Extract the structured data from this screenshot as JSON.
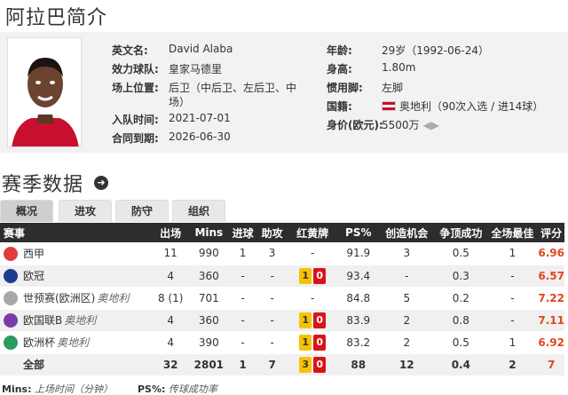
{
  "page_title": "阿拉巴简介",
  "profile": {
    "labels": {
      "en_name": "英文名:",
      "club": "效力球队:",
      "position": "场上位置:",
      "join_date": "入队时间:",
      "contract": "合同到期:",
      "age": "年龄:",
      "height": "身高:",
      "foot": "惯用脚:",
      "nation": "国籍:",
      "value": "身价(欧元):"
    },
    "values": {
      "en_name": "David Alaba",
      "club": "皇家马德里",
      "position_line1": "后卫（中后卫、左后卫、中",
      "position_line2": "场）",
      "join_date": "2021-07-01",
      "contract": "2026-06-30",
      "age": "29岁（1992-06-24）",
      "height": "1.80m",
      "foot": "左脚",
      "nation": "奥地利（90次入选 / 进14球）",
      "value": "5500万"
    }
  },
  "section_title": "赛季数据",
  "tabs": [
    "概况",
    "进攻",
    "防守",
    "组织"
  ],
  "table": {
    "headers": [
      "赛事",
      "出场",
      "Mins",
      "进球",
      "助攻",
      "红黄牌",
      "PS%",
      "创造机会",
      "争顶成功",
      "全场最佳",
      "评分"
    ],
    "rows": [
      {
        "comp": "西甲",
        "sub": "",
        "apps": "11",
        "mins": "990",
        "goals": "1",
        "assists": "3",
        "cards": "-",
        "y": "",
        "r": "",
        "ps": "91.9",
        "chances": "3",
        "aerial": "0.5",
        "motm": "1",
        "rating": "6.96",
        "icon_color": "#e23b3b"
      },
      {
        "comp": "欧冠",
        "sub": "",
        "apps": "4",
        "mins": "360",
        "goals": "-",
        "assists": "-",
        "cards": "",
        "y": "1",
        "r": "0",
        "ps": "93.4",
        "chances": "-",
        "aerial": "0.3",
        "motm": "-",
        "rating": "6.57",
        "icon_color": "#1d3c8f"
      },
      {
        "comp": "世预赛(欧洲区)",
        "sub": "奥地利",
        "apps": "8 (1)",
        "mins": "701",
        "goals": "-",
        "assists": "-",
        "cards": "-",
        "y": "",
        "r": "",
        "ps": "84.8",
        "chances": "5",
        "aerial": "0.2",
        "motm": "-",
        "rating": "7.22",
        "icon_color": "#a8a8a8"
      },
      {
        "comp": "欧国联B",
        "sub": "奥地利",
        "apps": "4",
        "mins": "360",
        "goals": "-",
        "assists": "-",
        "cards": "",
        "y": "1",
        "r": "0",
        "ps": "83.9",
        "chances": "2",
        "aerial": "0.8",
        "motm": "-",
        "rating": "7.11",
        "icon_color": "#7a3aa8"
      },
      {
        "comp": "欧洲杯",
        "sub": "奥地利",
        "apps": "4",
        "mins": "390",
        "goals": "-",
        "assists": "-",
        "cards": "",
        "y": "1",
        "r": "0",
        "ps": "83.2",
        "chances": "2",
        "aerial": "0.5",
        "motm": "1",
        "rating": "6.92",
        "icon_color": "#2a9d5c"
      }
    ],
    "total": {
      "label": "全部",
      "apps": "32",
      "mins": "2801",
      "goals": "1",
      "assists": "7",
      "y": "3",
      "r": "0",
      "ps": "88",
      "chances": "12",
      "aerial": "0.4",
      "motm": "2",
      "rating": "7"
    }
  },
  "footer": {
    "mins_key": "Mins:",
    "mins_desc": "上场时间（分钟）",
    "ps_key": "PS%:",
    "ps_desc": "传球成功率"
  },
  "colors": {
    "rating": "#e2461e",
    "header_bg": "#2d2d2d",
    "yellow_card": "#f5c400",
    "red_card": "#d7141a"
  }
}
